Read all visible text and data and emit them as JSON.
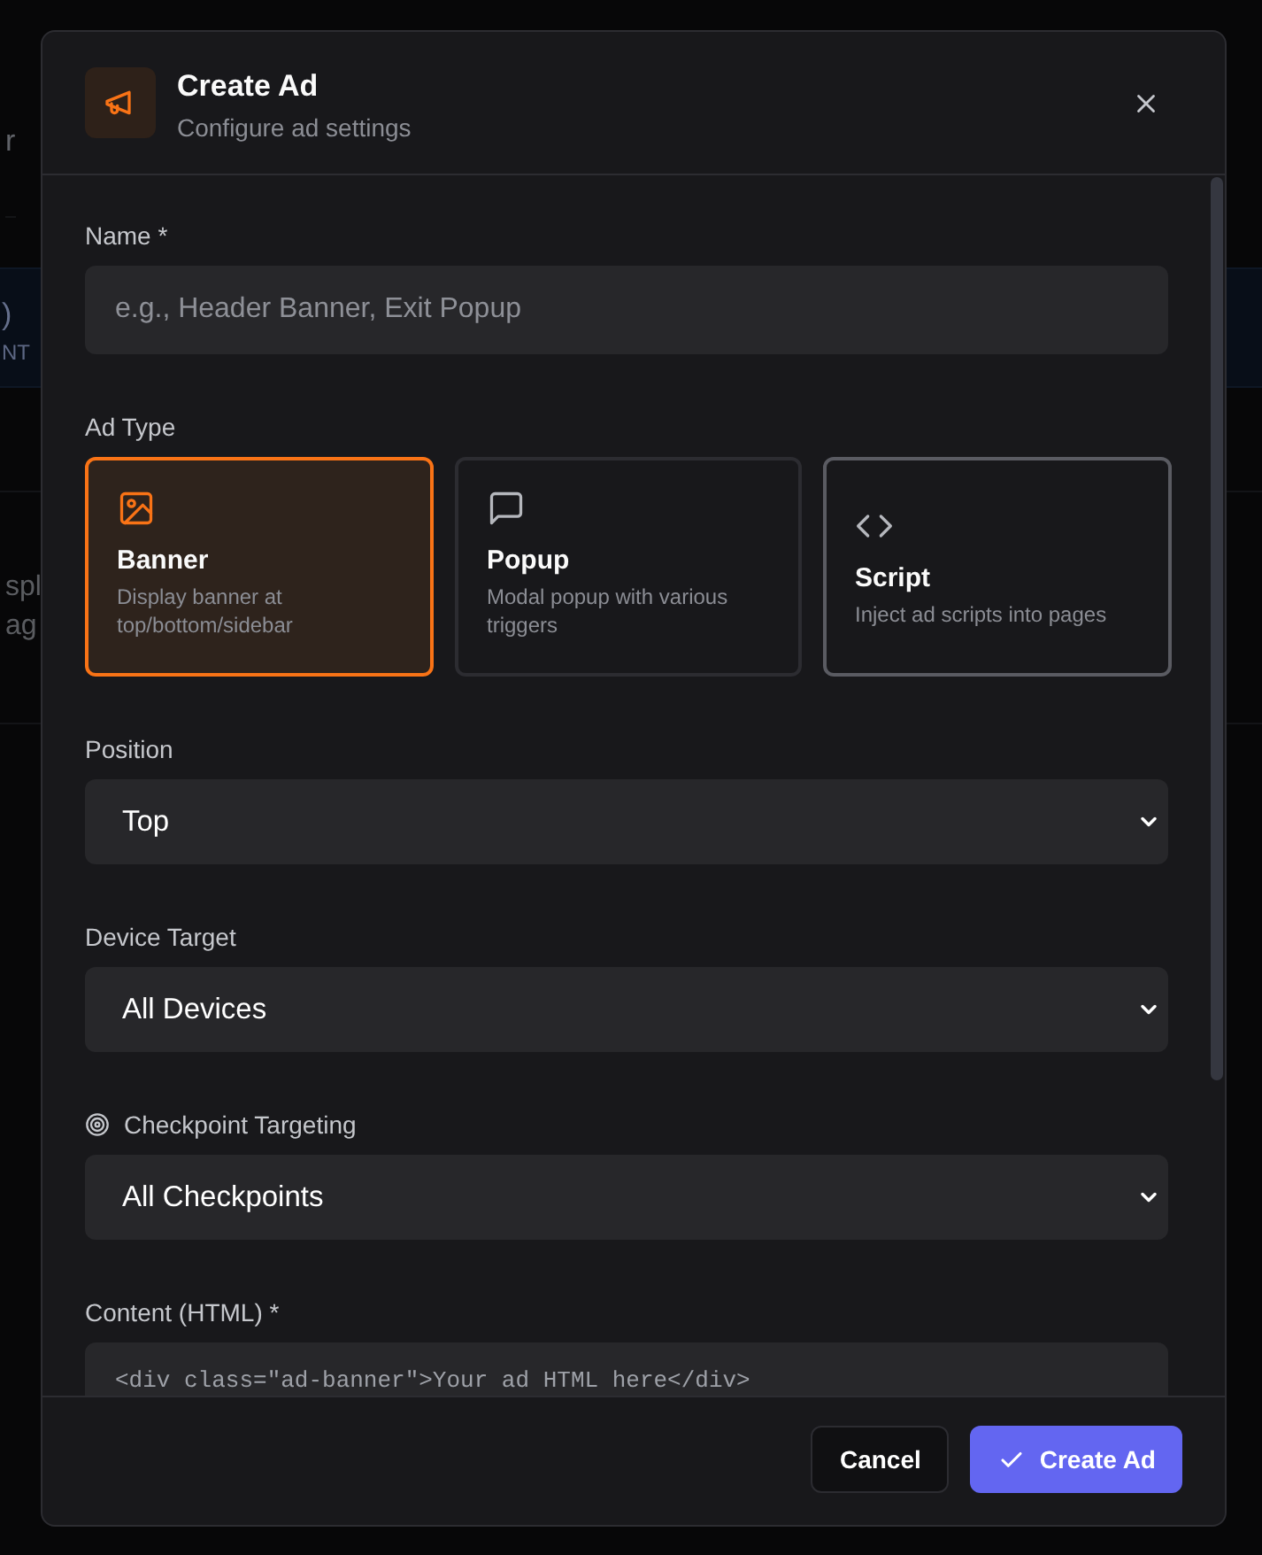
{
  "background": {
    "fragments": [
      {
        "text": "r",
        "kind": "heading"
      },
      {
        "text": ")",
        "kind": "band-title"
      },
      {
        "text": "NT",
        "kind": "band-sub"
      },
      {
        "text": "spl",
        "kind": "body"
      },
      {
        "text": "ag",
        "kind": "body"
      }
    ]
  },
  "dialog": {
    "title": "Create Ad",
    "subtitle": "Configure ad settings",
    "fields": [
      {
        "kind": "text",
        "label": "Name *",
        "placeholder": "e.g., Header Banner, Exit Popup"
      },
      {
        "kind": "cards",
        "label": "Ad Type",
        "options": [
          {
            "kind": "image",
            "title": "Banner",
            "description": "Display banner at top/bottom/sidebar",
            "selected": true,
            "hovered": false
          },
          {
            "kind": "chat",
            "title": "Popup",
            "description": "Modal popup with various triggers",
            "selected": false,
            "hovered": false
          },
          {
            "kind": "code",
            "title": "Script",
            "description": "Inject ad scripts into pages",
            "selected": false,
            "hovered": true
          }
        ]
      },
      {
        "kind": "select",
        "label": "Position",
        "value": "Top"
      },
      {
        "kind": "select",
        "label": "Device Target",
        "value": "All Devices"
      },
      {
        "kind": "select-with-icon",
        "label": "Checkpoint Targeting",
        "value": "All Checkpoints"
      },
      {
        "kind": "code",
        "label": "Content (HTML) *",
        "placeholder": "<div class=\"ad-banner\">Your ad HTML here</div>"
      }
    ],
    "buttons": [
      {
        "kind": "secondary",
        "label": "Cancel"
      },
      {
        "kind": "primary",
        "label": "Create Ad"
      }
    ]
  }
}
